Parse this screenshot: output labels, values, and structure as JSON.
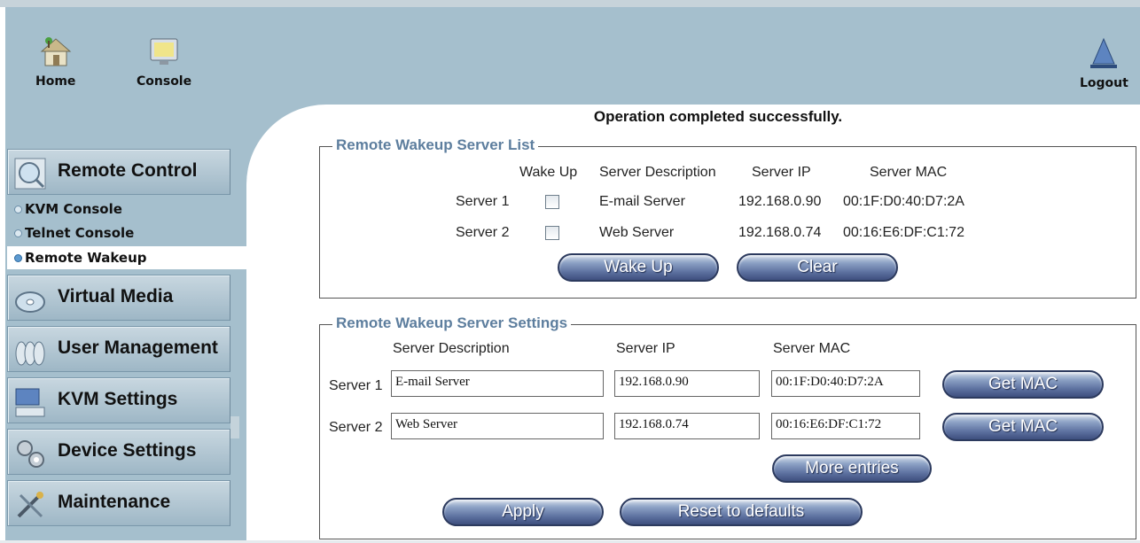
{
  "header": {
    "home_label": "Home",
    "console_label": "Console",
    "logout_label": "Logout"
  },
  "sidebar": {
    "remote_control": "Remote Control",
    "sub_items": [
      "KVM Console",
      "Telnet Console",
      "Remote Wakeup"
    ],
    "virtual_media": "Virtual Media",
    "user_management": "User Management",
    "kvm_settings": "KVM Settings",
    "device_settings": "Device Settings",
    "maintenance": "Maintenance"
  },
  "status_message": "Operation completed successfully.",
  "server_list": {
    "title": "Remote Wakeup Server List",
    "headers": {
      "wake_up": "Wake Up",
      "description": "Server Description",
      "ip": "Server IP",
      "mac": "Server MAC"
    },
    "rows": [
      {
        "label": "Server 1",
        "checked": false,
        "description": "E-mail Server",
        "ip": "192.168.0.90",
        "mac": "00:1F:D0:40:D7:2A"
      },
      {
        "label": "Server 2",
        "checked": false,
        "description": "Web Server",
        "ip": "192.168.0.74",
        "mac": "00:16:E6:DF:C1:72"
      }
    ],
    "wake_up_button": "Wake Up",
    "clear_button": "Clear"
  },
  "server_settings": {
    "title": "Remote Wakeup Server Settings",
    "headers": {
      "description": "Server Description",
      "ip": "Server IP",
      "mac": "Server MAC"
    },
    "rows": [
      {
        "label": "Server 1",
        "description": "E-mail Server",
        "ip": "192.168.0.90",
        "mac": "00:1F:D0:40:D7:2A",
        "get_mac": "Get MAC"
      },
      {
        "label": "Server 2",
        "description": "Web Server",
        "ip": "192.168.0.74",
        "mac": "00:16:E6:DF:C1:72",
        "get_mac": "Get MAC"
      }
    ],
    "more_entries_button": "More entries",
    "apply_button": "Apply",
    "reset_button": "Reset to defaults"
  },
  "colors": {
    "panel": "#a5bfcd",
    "title_blue": "#5d7e9e",
    "button_dark": "#3e4f7e"
  }
}
